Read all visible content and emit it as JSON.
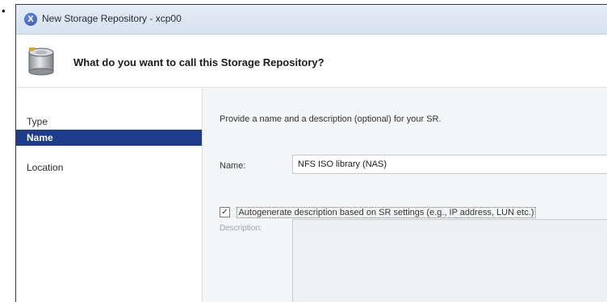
{
  "bullet": "•",
  "window": {
    "title": "New Storage Repository - xcp00",
    "title_icon": "xencenter-app-icon"
  },
  "header": {
    "icon": "storage-disk-icon",
    "heading": "What do you want to call this Storage Repository?"
  },
  "nav": {
    "items": [
      {
        "label": "Type",
        "selected": false
      },
      {
        "label": "Name",
        "selected": true
      },
      {
        "label": "Location",
        "selected": false
      }
    ]
  },
  "form": {
    "intro": "Provide a name and a description (optional) for your SR.",
    "name_label": "Name:",
    "name_value": "NFS ISO library (NAS)",
    "autogenerate_checked": true,
    "autogenerate_label": "Autogenerate description based on SR settings (e.g., IP address, LUN etc.)",
    "description_label": "Description:",
    "description_value": ""
  },
  "colors": {
    "selected_nav_bg": "#1f3b8c",
    "titlebar_bg": "#dbe5f1",
    "content_bg": "#f3f5f7"
  }
}
